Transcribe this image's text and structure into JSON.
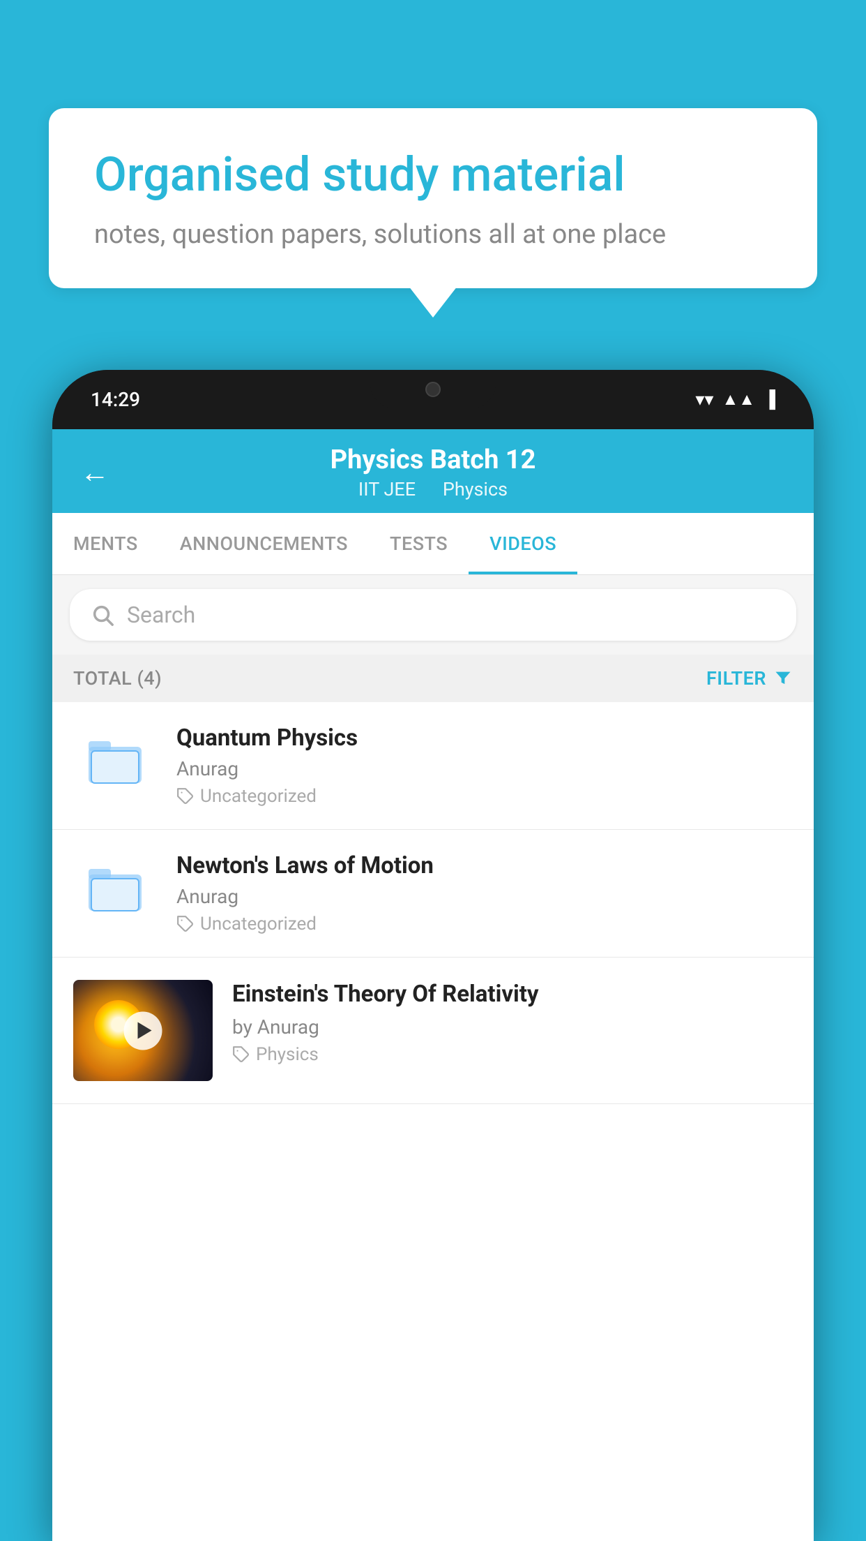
{
  "background_color": "#29b6d8",
  "bubble": {
    "title": "Organised study material",
    "subtitle": "notes, question papers, solutions all at one place"
  },
  "phone": {
    "status_bar": {
      "time": "14:29"
    },
    "header": {
      "title": "Physics Batch 12",
      "subtitle_part1": "IIT JEE",
      "subtitle_part2": "Physics",
      "back_label": "←"
    },
    "tabs": [
      {
        "label": "MENTS",
        "active": false
      },
      {
        "label": "ANNOUNCEMENTS",
        "active": false
      },
      {
        "label": "TESTS",
        "active": false
      },
      {
        "label": "VIDEOS",
        "active": true
      }
    ],
    "search": {
      "placeholder": "Search"
    },
    "filter": {
      "total_label": "TOTAL (4)",
      "filter_label": "FILTER"
    },
    "videos": [
      {
        "id": 1,
        "title": "Quantum Physics",
        "author": "Anurag",
        "tag": "Uncategorized",
        "has_thumbnail": false
      },
      {
        "id": 2,
        "title": "Newton's Laws of Motion",
        "author": "Anurag",
        "tag": "Uncategorized",
        "has_thumbnail": false
      },
      {
        "id": 3,
        "title": "Einstein's Theory Of Relativity",
        "author": "by Anurag",
        "tag": "Physics",
        "has_thumbnail": true
      }
    ]
  }
}
